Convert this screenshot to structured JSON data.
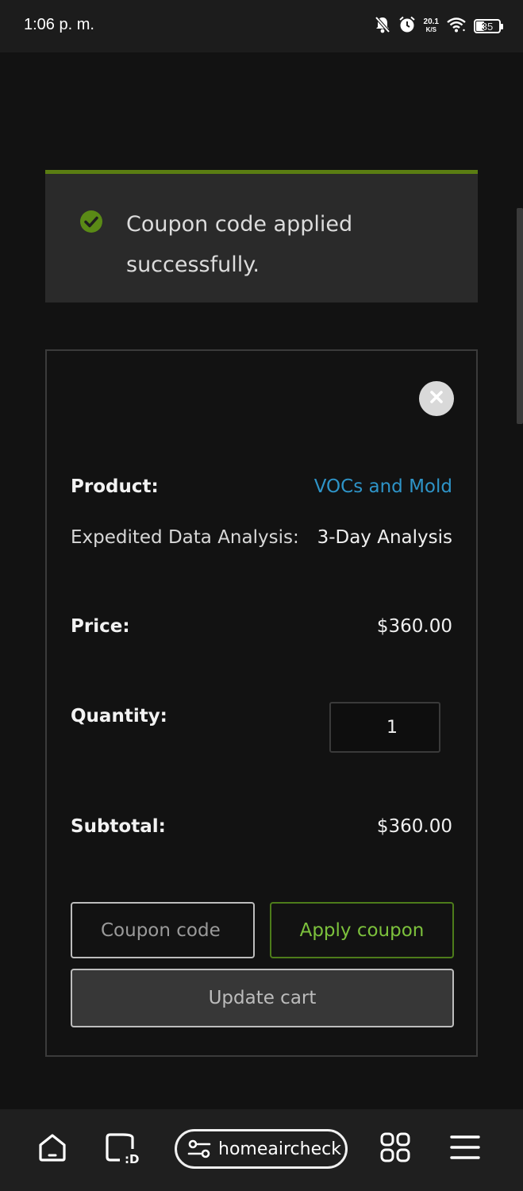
{
  "status_bar": {
    "time": "1:06 p. m.",
    "net_speed_value": "20.1",
    "net_speed_unit": "K/S",
    "battery_level": "35",
    "icons": [
      "bell-off-icon",
      "alarm-icon",
      "wifi-icon",
      "battery-icon"
    ]
  },
  "notice": {
    "message": "Coupon code applied successfully.",
    "icon": "check-circle-icon",
    "accent_color": "#5a7d12"
  },
  "cart": {
    "remove_icon": "close-icon",
    "product_label": "Product:",
    "product_name": "VOCs and Mold",
    "option_label": "Expedited Data Analysis:",
    "option_value": "3-Day Analysis",
    "price_label": "Price:",
    "price_value": "$360.00",
    "quantity_label": "Quantity:",
    "quantity_value": "1",
    "subtotal_label": "Subtotal:",
    "subtotal_value": "$360.00",
    "coupon_placeholder": "Coupon code",
    "apply_label": "Apply coupon",
    "update_label": "Update cart"
  },
  "browser_bar": {
    "url": "homeaircheck",
    "icons": [
      "home-icon",
      "tabs-icon",
      "site-settings-icon",
      "apps-grid-icon",
      "menu-icon"
    ]
  },
  "colors": {
    "link": "#2e94c8",
    "success": "#7cc13c",
    "background": "#121212"
  }
}
